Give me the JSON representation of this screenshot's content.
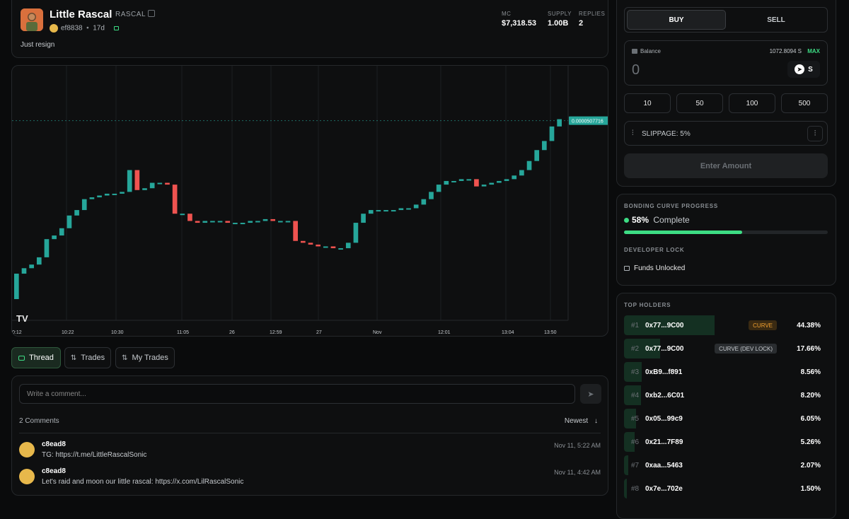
{
  "token": {
    "name": "Little Rascal",
    "ticker": "RASCAL",
    "creator": "ef8838",
    "age": "17d",
    "description": "Just resign"
  },
  "stats": [
    {
      "label": "MC",
      "value": "$7,318.53"
    },
    {
      "label": "SUPPLY",
      "value": "1.00B"
    },
    {
      "label": "REPLIES",
      "value": "2"
    }
  ],
  "chart_data": {
    "type": "candlestick",
    "price_label": "0.0000507716",
    "x_tick_labels": [
      "0:12",
      "10:22",
      "10:30",
      "11:05",
      "26",
      "12:59",
      "27",
      "Nov",
      "12:01",
      "13:04",
      "13:50"
    ],
    "candles_relative": [
      [
        0.0,
        0.14,
        0.0,
        0.14
      ],
      [
        0.14,
        0.17,
        0.14,
        0.17
      ],
      [
        0.17,
        0.19,
        0.17,
        0.19
      ],
      [
        0.19,
        0.23,
        0.19,
        0.23
      ],
      [
        0.23,
        0.33,
        0.23,
        0.33
      ],
      [
        0.33,
        0.35,
        0.33,
        0.35
      ],
      [
        0.35,
        0.39,
        0.35,
        0.39
      ],
      [
        0.39,
        0.46,
        0.39,
        0.46
      ],
      [
        0.46,
        0.49,
        0.46,
        0.49
      ],
      [
        0.49,
        0.55,
        0.49,
        0.55
      ],
      [
        0.55,
        0.56,
        0.55,
        0.56
      ],
      [
        0.56,
        0.57,
        0.56,
        0.57
      ],
      [
        0.57,
        0.58,
        0.57,
        0.58
      ],
      [
        0.58,
        0.58,
        0.58,
        0.58
      ],
      [
        0.58,
        0.59,
        0.58,
        0.59
      ],
      [
        0.59,
        0.71,
        0.59,
        0.71
      ],
      [
        0.71,
        0.6,
        0.6,
        0.71
      ],
      [
        0.6,
        0.61,
        0.6,
        0.61
      ],
      [
        0.61,
        0.64,
        0.61,
        0.64
      ],
      [
        0.64,
        0.64,
        0.64,
        0.64
      ],
      [
        0.64,
        0.63,
        0.63,
        0.64
      ],
      [
        0.63,
        0.47,
        0.47,
        0.63
      ],
      [
        0.47,
        0.47,
        0.47,
        0.47
      ],
      [
        0.47,
        0.43,
        0.43,
        0.47
      ],
      [
        0.43,
        0.42,
        0.42,
        0.43
      ],
      [
        0.42,
        0.43,
        0.42,
        0.43
      ],
      [
        0.43,
        0.43,
        0.43,
        0.43
      ],
      [
        0.43,
        0.43,
        0.43,
        0.43
      ],
      [
        0.43,
        0.42,
        0.42,
        0.43
      ],
      [
        0.42,
        0.42,
        0.42,
        0.42
      ],
      [
        0.42,
        0.42,
        0.42,
        0.42
      ],
      [
        0.42,
        0.43,
        0.42,
        0.43
      ],
      [
        0.43,
        0.43,
        0.43,
        0.43
      ],
      [
        0.43,
        0.44,
        0.43,
        0.44
      ],
      [
        0.44,
        0.43,
        0.43,
        0.44
      ],
      [
        0.43,
        0.43,
        0.43,
        0.43
      ],
      [
        0.43,
        0.43,
        0.43,
        0.43
      ],
      [
        0.43,
        0.32,
        0.32,
        0.43
      ],
      [
        0.32,
        0.31,
        0.31,
        0.32
      ],
      [
        0.31,
        0.3,
        0.3,
        0.31
      ],
      [
        0.3,
        0.29,
        0.29,
        0.3
      ],
      [
        0.29,
        0.29,
        0.29,
        0.29
      ],
      [
        0.29,
        0.28,
        0.28,
        0.29
      ],
      [
        0.28,
        0.28,
        0.28,
        0.28
      ],
      [
        0.28,
        0.31,
        0.28,
        0.31
      ],
      [
        0.31,
        0.42,
        0.31,
        0.42
      ],
      [
        0.42,
        0.47,
        0.42,
        0.47
      ],
      [
        0.47,
        0.49,
        0.47,
        0.49
      ],
      [
        0.49,
        0.49,
        0.49,
        0.49
      ],
      [
        0.49,
        0.49,
        0.49,
        0.49
      ],
      [
        0.49,
        0.49,
        0.49,
        0.49
      ],
      [
        0.49,
        0.5,
        0.49,
        0.5
      ],
      [
        0.5,
        0.5,
        0.5,
        0.5
      ],
      [
        0.5,
        0.52,
        0.5,
        0.52
      ],
      [
        0.52,
        0.55,
        0.52,
        0.55
      ],
      [
        0.55,
        0.59,
        0.55,
        0.59
      ],
      [
        0.59,
        0.63,
        0.59,
        0.63
      ],
      [
        0.63,
        0.65,
        0.63,
        0.65
      ],
      [
        0.65,
        0.65,
        0.65,
        0.65
      ],
      [
        0.65,
        0.66,
        0.65,
        0.66
      ],
      [
        0.66,
        0.66,
        0.66,
        0.66
      ],
      [
        0.66,
        0.62,
        0.62,
        0.66
      ],
      [
        0.62,
        0.63,
        0.62,
        0.63
      ],
      [
        0.63,
        0.64,
        0.63,
        0.64
      ],
      [
        0.64,
        0.65,
        0.64,
        0.65
      ],
      [
        0.65,
        0.66,
        0.65,
        0.66
      ],
      [
        0.66,
        0.68,
        0.66,
        0.68
      ],
      [
        0.68,
        0.71,
        0.68,
        0.71
      ],
      [
        0.71,
        0.76,
        0.71,
        0.76
      ],
      [
        0.76,
        0.82,
        0.76,
        0.82
      ],
      [
        0.82,
        0.87,
        0.82,
        0.87
      ],
      [
        0.87,
        0.95,
        0.87,
        0.95
      ],
      [
        0.95,
        0.99,
        0.95,
        0.99
      ]
    ]
  },
  "tabs": [
    {
      "label": "Thread",
      "active": true
    },
    {
      "label": "Trades",
      "active": false
    },
    {
      "label": "My Trades",
      "active": false
    }
  ],
  "comments_section": {
    "placeholder": "Write a comment...",
    "count_label": "2 Comments",
    "sort_label": "Newest",
    "items": [
      {
        "user": "c8ead8",
        "text": "TG: https://t.me/LittleRascalSonic",
        "date": "Nov 11, 5:22 AM"
      },
      {
        "user": "c8ead8",
        "text": "Let's raid and moon our little rascal: https://x.com/LilRascalSonic",
        "date": "Nov 11, 4:42 AM"
      }
    ]
  },
  "trade": {
    "buy_label": "BUY",
    "sell_label": "SELL",
    "balance_label": "Balance",
    "balance_value": "1072.8094 S",
    "max_label": "MAX",
    "amount_value": "0",
    "currency": "S",
    "quick_amounts": [
      "10",
      "50",
      "100",
      "500"
    ],
    "slippage_label": "SLIPPAGE: 5%",
    "submit_label": "Enter Amount"
  },
  "bonding": {
    "title": "BONDING CURVE PROGRESS",
    "percent_label": "58%",
    "complete_label": "Complete",
    "progress": 0.58,
    "dev_lock_title": "DEVELOPER LOCK",
    "dev_lock_status": "Funds Unlocked"
  },
  "holders": {
    "title": "TOP HOLDERS",
    "rows": [
      {
        "rank": "#1",
        "address": "0x77...9C00",
        "badge": "CURVE",
        "badge_style": "curve",
        "percent": "44.38%",
        "fill": 0.4438
      },
      {
        "rank": "#2",
        "address": "0x77...9C00",
        "badge": "CURVE (DEV LOCK)",
        "badge_style": "dev",
        "percent": "17.66%",
        "fill": 0.1766
      },
      {
        "rank": "#3",
        "address": "0xB9...f891",
        "badge": "",
        "badge_style": "",
        "percent": "8.56%",
        "fill": 0.0856
      },
      {
        "rank": "#4",
        "address": "0xb2...6C01",
        "badge": "",
        "badge_style": "",
        "percent": "8.20%",
        "fill": 0.082
      },
      {
        "rank": "#5",
        "address": "0x05...99c9",
        "badge": "",
        "badge_style": "",
        "percent": "6.05%",
        "fill": 0.0605
      },
      {
        "rank": "#6",
        "address": "0x21...7F89",
        "badge": "",
        "badge_style": "",
        "percent": "5.26%",
        "fill": 0.0526
      },
      {
        "rank": "#7",
        "address": "0xaa...5463",
        "badge": "",
        "badge_style": "",
        "percent": "2.07%",
        "fill": 0.0207
      },
      {
        "rank": "#8",
        "address": "0x7e...702e",
        "badge": "",
        "badge_style": "",
        "percent": "1.50%",
        "fill": 0.015
      }
    ]
  },
  "colors": {
    "up": "#26a69a",
    "down": "#ef5350",
    "accent": "#3ddc84",
    "curve_badge": "#f0a030"
  }
}
